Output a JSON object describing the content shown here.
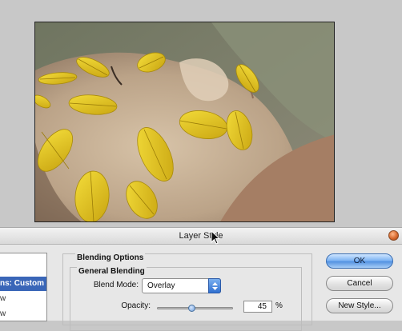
{
  "dialog": {
    "title": "Layer Style",
    "style_list": {
      "items": [
        {
          "label": "ns: Custom",
          "selected": true
        },
        {
          "label": "w",
          "selected": false
        },
        {
          "label": "w",
          "selected": false
        }
      ]
    },
    "blending_options": {
      "title": "Blending Options",
      "general": {
        "title": "General Blending",
        "blend_mode_label": "Blend Mode:",
        "blend_mode_value": "Overlay",
        "opacity_label": "Opacity:",
        "opacity_value": "45",
        "opacity_unit": "%",
        "opacity_fraction": 0.45
      }
    },
    "buttons": {
      "ok": "OK",
      "cancel": "Cancel",
      "new_style": "New Style..."
    }
  },
  "colors": {
    "background": "#c8c8c8",
    "selection": "#3a66b8",
    "leaf": "#e8c81c",
    "close_button": "#d86a2e"
  }
}
